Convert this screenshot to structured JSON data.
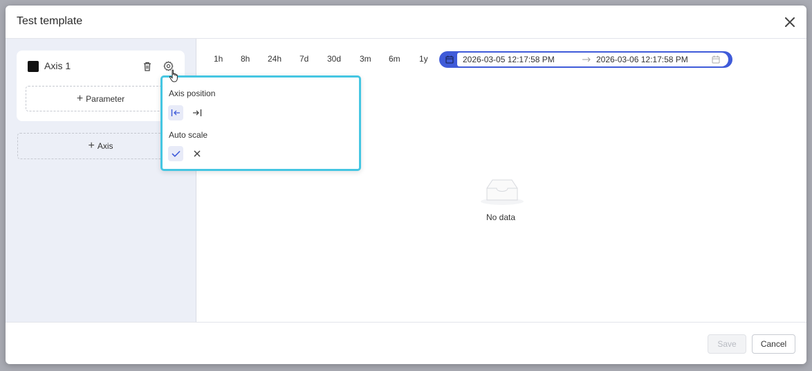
{
  "modal": {
    "title": "Test template"
  },
  "sidebar": {
    "axis_card": {
      "label": "Axis 1",
      "swatch_color": "#111111",
      "add_parameter_label": "Parameter"
    },
    "add_axis_label": "Axis"
  },
  "toolbar": {
    "ranges": [
      "1h",
      "8h",
      "24h",
      "7d",
      "30d",
      "3m",
      "6m",
      "1y"
    ],
    "date_range": {
      "start": "2026-03-05 12:17:58 PM",
      "end": "2026-03-06 12:17:58 PM",
      "accent": "#3f5bd9"
    }
  },
  "popover": {
    "axis_position_label": "Axis position",
    "axis_position_selected": "left",
    "auto_scale_label": "Auto scale",
    "auto_scale_selected": "on",
    "border_color": "#45c6e2"
  },
  "empty_state": {
    "text": "No data"
  },
  "footer": {
    "save_label": "Save",
    "cancel_label": "Cancel"
  }
}
